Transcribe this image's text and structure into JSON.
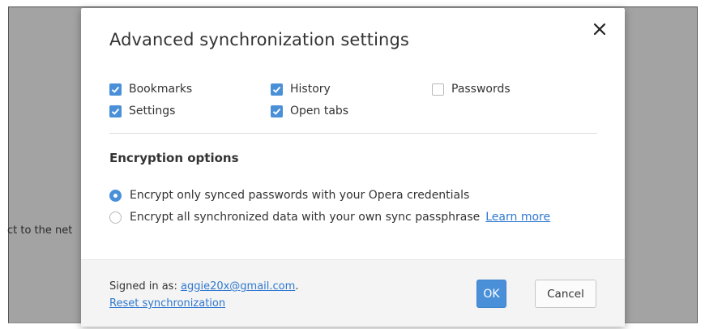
{
  "background": {
    "partial_text": "ct to the net"
  },
  "dialog": {
    "title": "Advanced synchronization settings",
    "close_icon": "close-icon",
    "sync_options": [
      {
        "label": "Bookmarks",
        "checked": true
      },
      {
        "label": "History",
        "checked": true
      },
      {
        "label": "Passwords",
        "checked": false
      },
      {
        "label": "Settings",
        "checked": true
      },
      {
        "label": "Open tabs",
        "checked": true
      }
    ],
    "encryption": {
      "heading": "Encryption options",
      "options": [
        {
          "label": "Encrypt only synced passwords with your Opera credentials",
          "selected": true
        },
        {
          "label": "Encrypt all synchronized data with your own sync passphrase",
          "selected": false
        }
      ],
      "learn_more": "Learn more"
    },
    "footer": {
      "signed_in_prefix": "Signed in as:",
      "email": "aggie20x@gmail.com",
      "email_suffix": ".",
      "reset_link": "Reset synchronization",
      "ok_label": "OK",
      "cancel_label": "Cancel"
    }
  },
  "colors": {
    "accent": "#4a90d9",
    "link": "#2f78d0",
    "backdrop": "#a3a3a3",
    "footer_bg": "#f4f4f4"
  }
}
